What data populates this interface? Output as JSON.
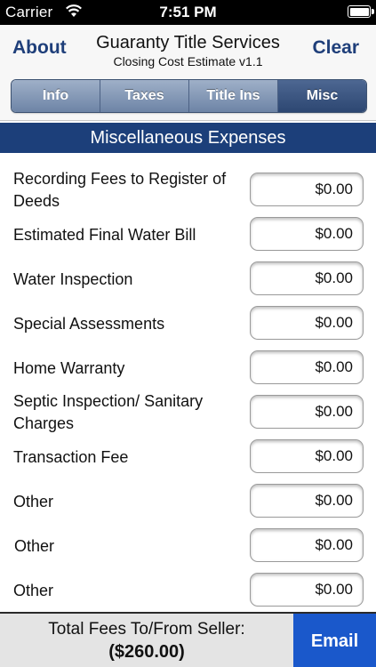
{
  "status_bar": {
    "carrier": "Carrier",
    "time": "7:51 PM"
  },
  "nav": {
    "about_label": "About",
    "title": "Guaranty Title Services",
    "subtitle": "Closing Cost Estimate v1.1",
    "clear_label": "Clear"
  },
  "tabs": [
    {
      "label": "Info",
      "selected": false
    },
    {
      "label": "Taxes",
      "selected": false
    },
    {
      "label": "Title Ins",
      "selected": false
    },
    {
      "label": "Misc",
      "selected": true
    }
  ],
  "section": {
    "title": "Miscellaneous Expenses"
  },
  "rows": [
    {
      "label": "Recording Fees to Register of Deeds",
      "value": "$0.00"
    },
    {
      "label": "Estimated Final Water Bill",
      "value": "$0.00"
    },
    {
      "label": "Water Inspection",
      "value": "$0.00"
    },
    {
      "label": "Special Assessments",
      "value": "$0.00"
    },
    {
      "label": "Home Warranty",
      "value": "$0.00"
    },
    {
      "label": "Septic Inspection/ Sanitary Charges",
      "value": "$0.00"
    },
    {
      "label": "Transaction Fee",
      "value": "$0.00"
    },
    {
      "label": "Other",
      "value": "$0.00"
    },
    {
      "label": "Other",
      "value": "$0.00"
    },
    {
      "label": "Other",
      "value": "$0.00"
    }
  ],
  "footer": {
    "total_label": "Total Fees To/From Seller:",
    "total_value": "($260.00)",
    "email_label": "Email"
  },
  "colors": {
    "nav_text": "#1f3f7a",
    "section_header": "#1c3f7a",
    "email_button": "#1a58cb"
  }
}
